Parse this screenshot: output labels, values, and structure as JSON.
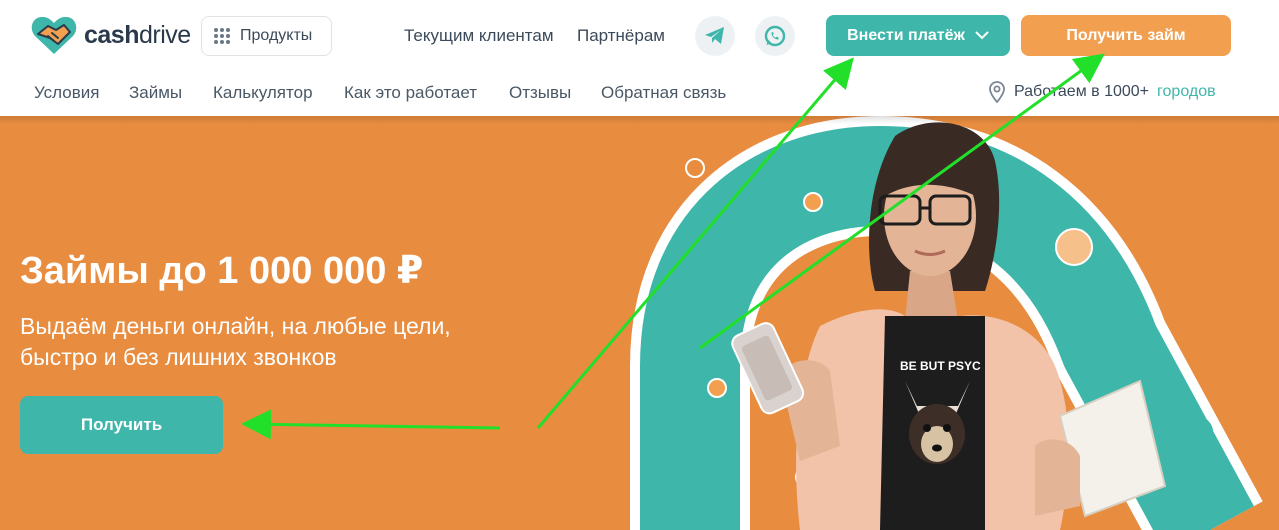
{
  "header": {
    "logo_text_bold": "cash",
    "logo_text_rest": "drive",
    "products_label": "Продукты",
    "links": [
      "Текущим клиентам",
      "Партнёрам"
    ],
    "pay_button_label": "Внести платёж",
    "loan_button_label": "Получить займ",
    "messengers": [
      "telegram-icon",
      "whatsapp-icon"
    ]
  },
  "nav": {
    "items": [
      "Условия",
      "Займы",
      "Калькулятор",
      "Как это работает",
      "Отзывы",
      "Обратная связь"
    ],
    "cities_text": "Работаем в 1000+",
    "cities_link": "городов"
  },
  "hero": {
    "title": "Займы до 1 000 000 ₽",
    "subtitle_line1": "Выдаём деньги онлайн, на любые цели,",
    "subtitle_line2": "быстро и без лишних звонков",
    "button_label": "Получить",
    "shirt_text": "BE BUT PSYC"
  },
  "colors": {
    "brand_teal": "#3fb6aa",
    "brand_orange": "#f2a050",
    "hero_background": "#e88c3f",
    "annotation_arrow": "#22e02a"
  }
}
